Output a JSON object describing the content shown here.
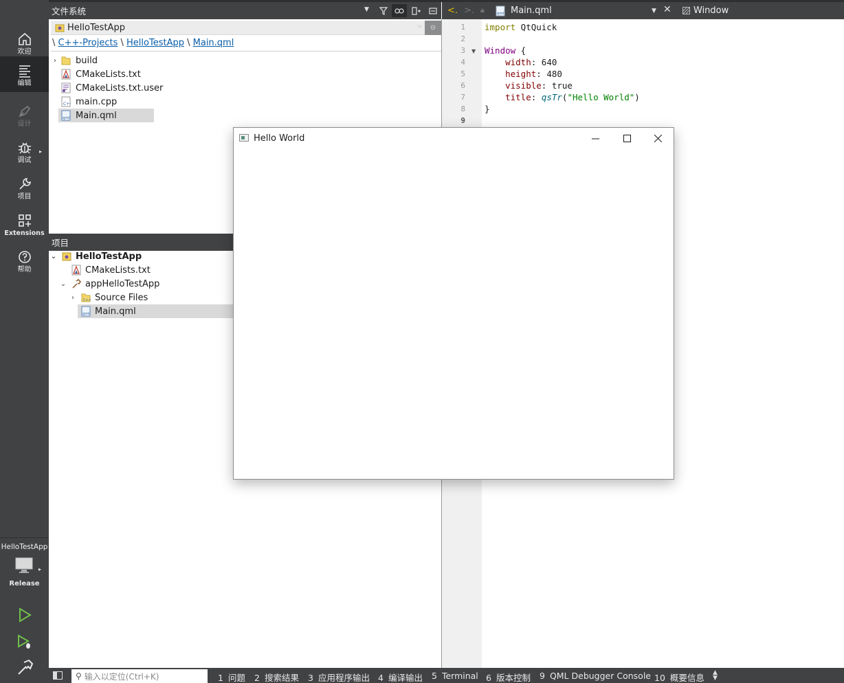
{
  "modes": [
    {
      "label": "欢迎",
      "icon": "home-icon"
    },
    {
      "label": "编辑",
      "icon": "edit-icon"
    },
    {
      "label": "设计",
      "icon": "pen-icon"
    },
    {
      "label": "调试",
      "icon": "bug-icon"
    },
    {
      "label": "项目",
      "icon": "wrench-icon"
    },
    {
      "label": "Extensions",
      "icon": "extensions-icon"
    },
    {
      "label": "帮助",
      "icon": "help-icon"
    }
  ],
  "kit": {
    "project": "HelloTestApp",
    "build": "Release"
  },
  "filesystem": {
    "header": "文件系统",
    "combo": "HelloTestApp",
    "breadcrumb": {
      "sep": "\\",
      "parts": [
        "C++-Projects",
        "HelloTestApp",
        "Main.qml"
      ]
    },
    "items": [
      {
        "label": "build",
        "icon": "folder-icon"
      },
      {
        "label": "CMakeLists.txt",
        "icon": "cmake-file-icon"
      },
      {
        "label": "CMakeLists.txt.user",
        "icon": "user-file-icon"
      },
      {
        "label": "main.cpp",
        "icon": "cpp-file-icon"
      },
      {
        "label": "Main.qml",
        "icon": "qml-file-icon",
        "selected": true
      }
    ]
  },
  "projects": {
    "header": "项目",
    "items": [
      {
        "label": "HelloTestApp",
        "icon": "project-icon",
        "bold": true
      },
      {
        "label": "CMakeLists.txt",
        "icon": "cmake-file-icon"
      },
      {
        "label": "appHelloTestApp",
        "icon": "hammer-icon"
      },
      {
        "label": "Source Files",
        "icon": "source-folder-icon"
      },
      {
        "label": "Main.qml",
        "icon": "qml-file-icon",
        "selected": true
      }
    ]
  },
  "editor": {
    "file": "Main.qml",
    "symbol": "Window",
    "line_numbers": [
      "1",
      "2",
      "3",
      "4",
      "5",
      "6",
      "7",
      "8",
      "9"
    ],
    "code": {
      "l1_kw": "import",
      "l1_rest": " QtQuick",
      "l3_type": "Window",
      "l3_rest": " {",
      "l4_prop": "width",
      "l4_rest": ": 640",
      "l5_prop": "height",
      "l5_rest": ": 480",
      "l6_prop": "visible",
      "l6_rest": ": true",
      "l7_prop": "title",
      "l7_colon": ": ",
      "l7_fn": "qsTr",
      "l7_open": "(",
      "l7_str": "\"Hello World\"",
      "l7_close": ")",
      "l8": "}"
    }
  },
  "app_window": {
    "title": "Hello World"
  },
  "statusbar": {
    "locator_placeholder": "输入以定位(Ctrl+K)",
    "panes": [
      {
        "num": "1",
        "label": "问题"
      },
      {
        "num": "2",
        "label": "搜索结果"
      },
      {
        "num": "3",
        "label": "应用程序输出"
      },
      {
        "num": "4",
        "label": "编译输出"
      },
      {
        "num": "5",
        "label": "Terminal"
      },
      {
        "num": "6",
        "label": "版本控制"
      },
      {
        "num": "9",
        "label": "QML Debugger Console"
      },
      {
        "num": "10",
        "label": "概要信息"
      }
    ]
  }
}
